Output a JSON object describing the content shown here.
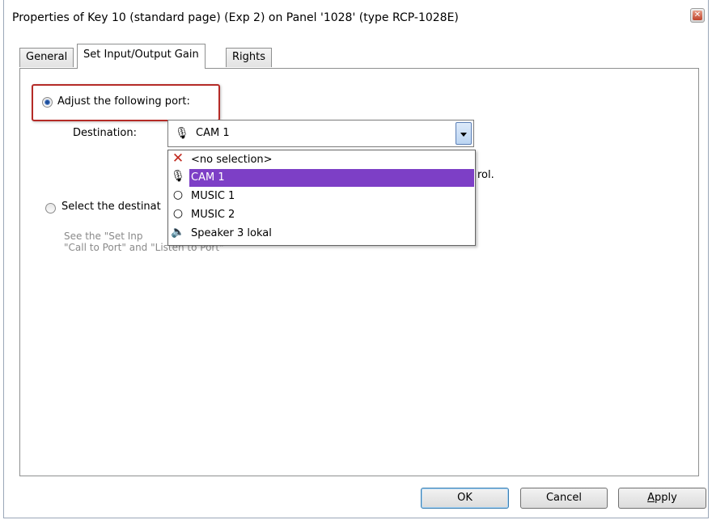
{
  "window": {
    "title": "Properties of Key 10 (standard page) (Exp 2) on Panel '1028' (type RCP-1028E)",
    "close_icon": "close-icon"
  },
  "tabs": [
    {
      "label": "General",
      "active": false
    },
    {
      "label": "Set Input/Output Gain",
      "active": true
    },
    {
      "label": "Rights",
      "active": false
    }
  ],
  "options": {
    "adjust_label": "Adjust the following port:",
    "adjust_checked": true,
    "select_label": "Select the destinat",
    "select_checked": false
  },
  "destination": {
    "label": "Destination:",
    "value": "CAM 1",
    "icon": "microphone-icon"
  },
  "dropdown": {
    "items": [
      {
        "label": "<no selection>",
        "icon": "x-icon",
        "selected": false
      },
      {
        "label": "CAM 1",
        "icon": "microphone-icon",
        "selected": true
      },
      {
        "label": "MUSIC 1",
        "icon": "circle-icon",
        "selected": false
      },
      {
        "label": "MUSIC 2",
        "icon": "circle-icon",
        "selected": false
      },
      {
        "label": "Speaker 3 lokal",
        "icon": "speaker-icon",
        "selected": false
      }
    ]
  },
  "partial_text": {
    "trailing": "rol.",
    "help_line1": "See the \"Set Inp",
    "help_line2": "\"Call to Port\" and \"Listen to Port\""
  },
  "buttons": {
    "ok": "OK",
    "cancel": "Cancel",
    "apply_rest": "pply",
    "apply_mnemonic": "A"
  },
  "colors": {
    "selection": "#7d3fc6",
    "highlight_border": "#b52b27"
  }
}
